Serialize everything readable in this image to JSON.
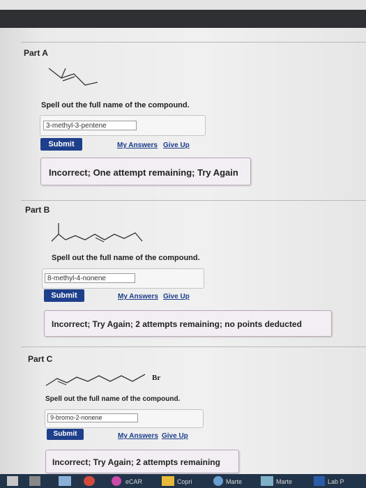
{
  "parts": [
    {
      "title": "Part A",
      "prompt": "Spell out the full name of the compound.",
      "answer": "3-methyl-3-pentene",
      "submit_label": "Submit",
      "my_answers_label": "My Answers",
      "give_up_label": "Give Up",
      "feedback": "Incorrect; One attempt remaining; Try Again"
    },
    {
      "title": "Part B",
      "prompt": "Spell out the full name of the compound.",
      "answer": "8-methyl-4-nonene",
      "submit_label": "Submit",
      "my_answers_label": "My Answers",
      "give_up_label": "Give Up",
      "feedback": "Incorrect; Try Again; 2 attempts remaining; no points deducted"
    },
    {
      "title": "Part C",
      "prompt": "Spell out the full name of the compound.",
      "answer": "9-bromo-2-nonene",
      "submit_label": "Submit",
      "my_answers_label": "My Answers",
      "give_up_label": "Give Up",
      "feedback": "Incorrect; Try Again; 2 attempts remaining",
      "substituent_label": "Br"
    }
  ],
  "taskbar": {
    "items": [
      "eCAR",
      "Copri",
      "Marte",
      "Marte",
      "Lab P"
    ]
  },
  "colors": {
    "submit": "#1e3f8c",
    "link": "#1a3c8a",
    "feedback_border": "#b9a7b9"
  }
}
